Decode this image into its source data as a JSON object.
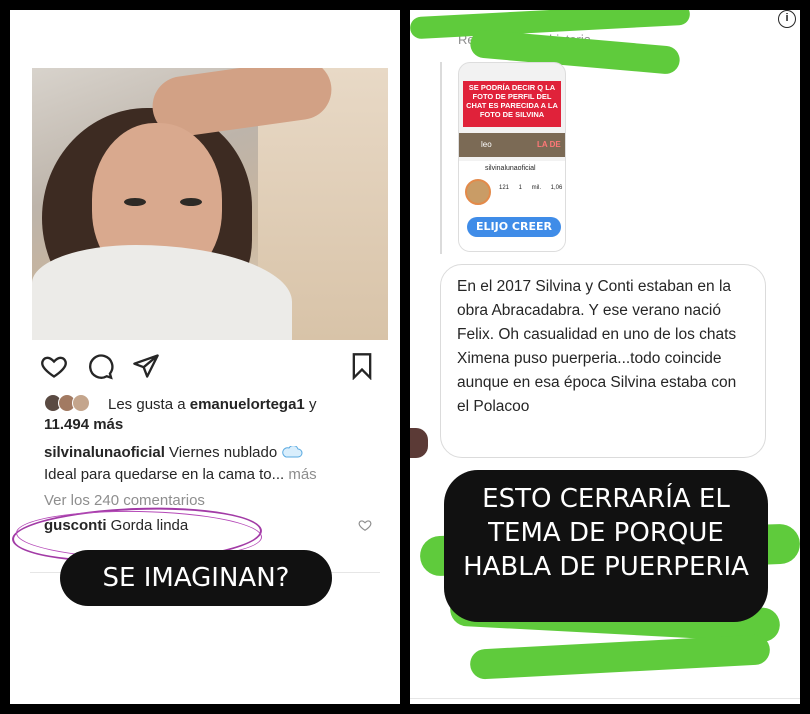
{
  "left_post": {
    "likes_text_prefix": "Les gusta a",
    "likes_user": "emanuelortega1",
    "likes_connector": "y",
    "likes_count": "11.494 más",
    "caption_user": "silvinalunaoficial",
    "caption_text": "Viernes nublado",
    "caption_line2": "Ideal para quedarse en la cama to...",
    "caption_more": "más",
    "view_comments": "Ver los 240 comentarios",
    "comment_user": "gusconti",
    "comment_text": "Gorda linda",
    "overlay_caption": "SE IMAGINAN?"
  },
  "right_dm": {
    "reply_title": "Respondió a tu historia",
    "story_sticker_text": "SE PODRÍA DECIR Q LA FOTO DE PERFIL DEL CHAT ES PARECIDA A LA FOTO DE SILVINA",
    "story_strip_left": "leo",
    "story_strip_right": "LA DE",
    "story_profile_name": "silvinalunaoficial",
    "story_stats": "121 1 mil. 1,06",
    "story_button": "ELIJO CREER",
    "message_text": "En el 2017 Silvina y Conti estaban en la obra Abracadabra. Y ese verano nació Felix. Oh casualidad en uno de los chats Ximena puso puerperia...todo coincide aunque en esa época Silvina estaba con el Polacoo",
    "overlay_caption": "ESTO CERRARÍA EL TEMA DE PORQUE HABLA DE PUERPERIA",
    "info_glyph": "i"
  },
  "colors": {
    "overlay_bg": "#111111",
    "scribble_green": "#5fcb3c",
    "circle_purple": "#a23ba6",
    "elijo_blue": "#3f8ce8",
    "sticker_red": "#e0223a"
  }
}
